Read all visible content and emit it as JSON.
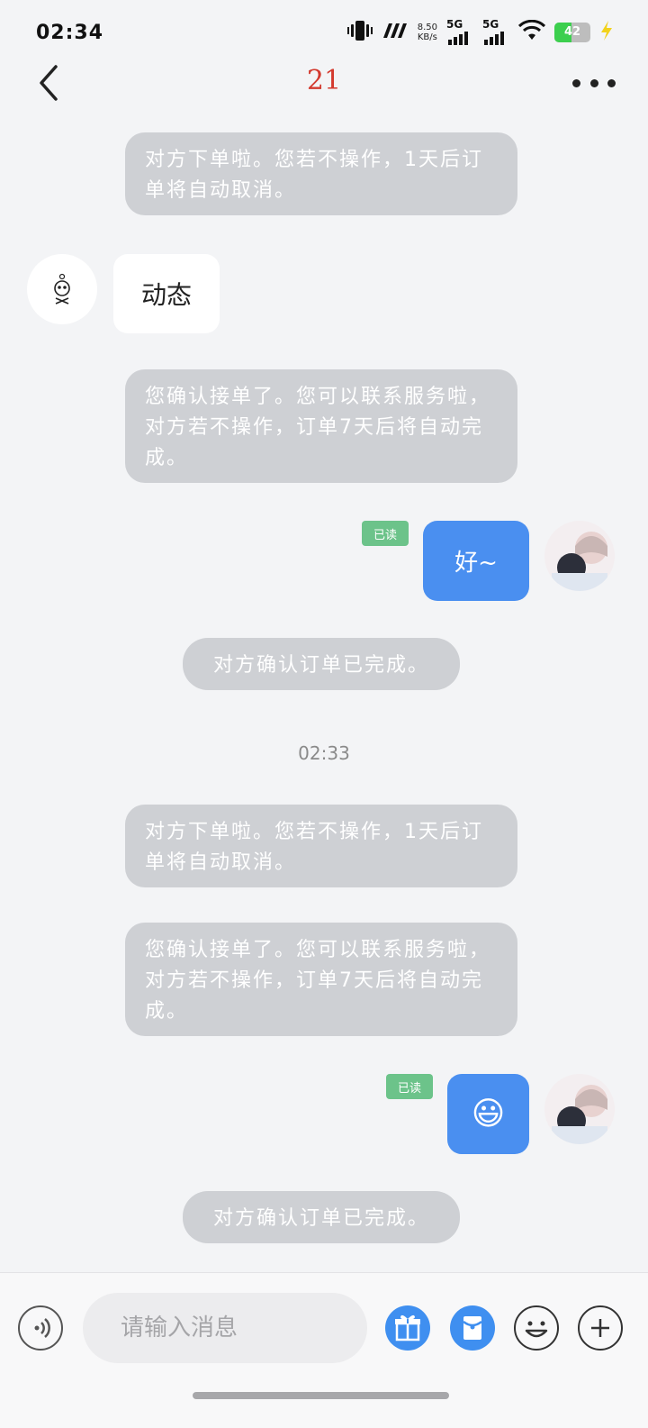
{
  "status_bar": {
    "time": "02:34",
    "net_speed_value": "8.50",
    "net_speed_unit": "KB/s",
    "signal_1_label": "5G",
    "signal_2_label": "5G",
    "battery_level": "42"
  },
  "header": {
    "title": "21"
  },
  "messages": [
    {
      "type": "system",
      "text": "对方下单啦。您若不操作，1天后订单将自动取消。"
    },
    {
      "type": "received",
      "text": "动态"
    },
    {
      "type": "system",
      "text": "您确认接单了。您可以联系服务啦，对方若不操作，订单7天后将自动完成。"
    },
    {
      "type": "sent",
      "text": "好~",
      "status": "已读"
    },
    {
      "type": "system",
      "text": "对方确认订单已完成。"
    },
    {
      "type": "timestamp",
      "text": "02:33"
    },
    {
      "type": "system",
      "text": "对方下单啦。您若不操作，1天后订单将自动取消。"
    },
    {
      "type": "system",
      "text": "您确认接单了。您可以联系服务啦，对方若不操作，订单7天后将自动完成。"
    },
    {
      "type": "sent",
      "text": "😃",
      "status": "已读"
    },
    {
      "type": "system",
      "text": "对方确认订单已完成。"
    }
  ],
  "input_bar": {
    "placeholder": "请输入消息"
  },
  "colors": {
    "accent": "#4a8ff0",
    "read_badge": "#6cc38a",
    "system_bubble": "#ced0d4",
    "title": "#d33a2f"
  }
}
